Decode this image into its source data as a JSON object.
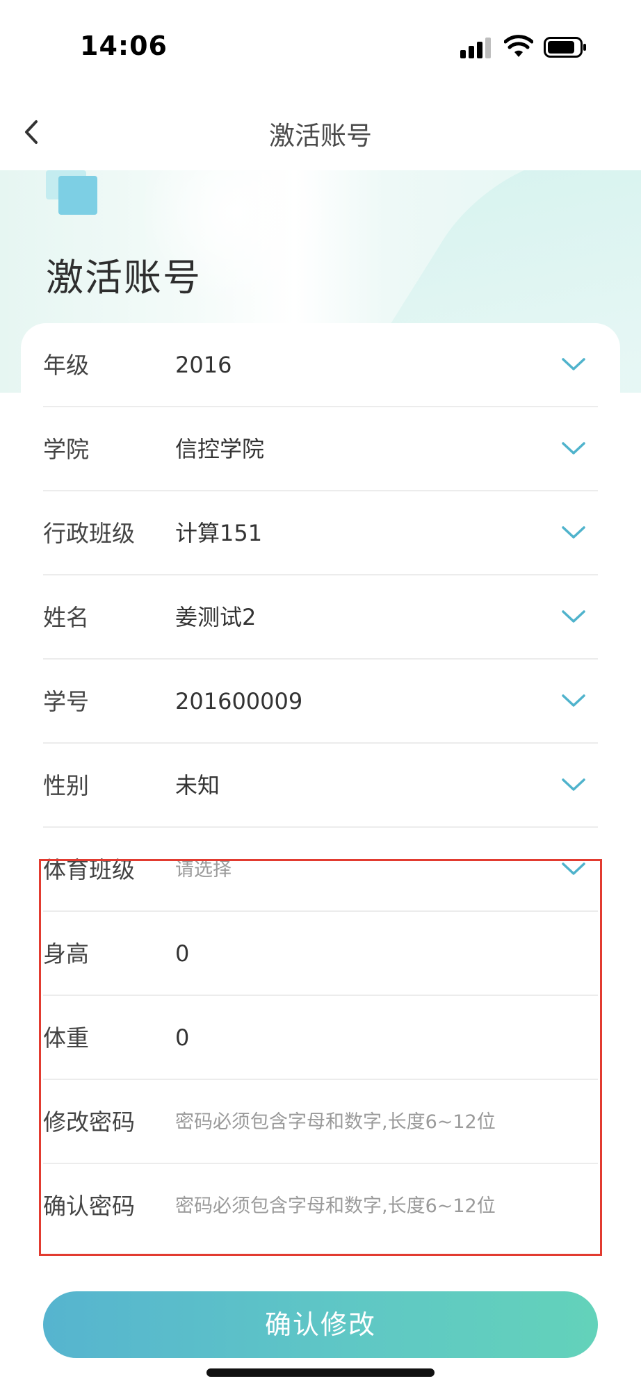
{
  "status_bar": {
    "time": "14:06"
  },
  "nav": {
    "title": "激活账号"
  },
  "header": {
    "heading": "激活账号"
  },
  "form": {
    "rows": [
      {
        "label": "年级",
        "value": "2016",
        "has_dropdown": true
      },
      {
        "label": "学院",
        "value": "信控学院",
        "has_dropdown": true
      },
      {
        "label": "行政班级",
        "value": "计算151",
        "has_dropdown": true
      },
      {
        "label": "姓名",
        "value": "姜测试2",
        "has_dropdown": true
      },
      {
        "label": "学号",
        "value": "201600009",
        "has_dropdown": true
      },
      {
        "label": "性别",
        "value": "未知",
        "has_dropdown": true
      },
      {
        "label": "体育班级",
        "placeholder": "请选择",
        "has_dropdown": true
      },
      {
        "label": "身高",
        "value": "0",
        "has_dropdown": false
      },
      {
        "label": "体重",
        "value": "0",
        "has_dropdown": false
      },
      {
        "label": "修改密码",
        "placeholder": "密码必须包含字母和数字,长度6~12位",
        "has_dropdown": false
      },
      {
        "label": "确认密码",
        "placeholder": "密码必须包含字母和数字,长度6~12位",
        "has_dropdown": false
      }
    ]
  },
  "submit": {
    "label": "确认修改"
  },
  "colors": {
    "accent": "#5ab8cf",
    "chevron": "#4fb3cc",
    "highlight": "#e23b30",
    "button_gradient_start": "#56b4cf",
    "button_gradient_end": "#63d2ba"
  },
  "icons": [
    "back-chevron-icon",
    "chevron-down-icon",
    "signal-icon",
    "wifi-icon",
    "battery-icon"
  ]
}
